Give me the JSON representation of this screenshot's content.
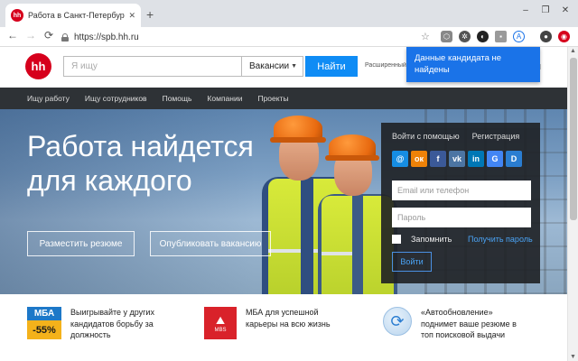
{
  "browser": {
    "tab_title": "Работа в Санкт-Петербурге, по",
    "tab_favicon_text": "hh",
    "tab_close": "✕",
    "new_tab": "+",
    "url": "https://spb.hh.ru",
    "window_controls": [
      "–",
      "❐",
      "✕"
    ]
  },
  "header": {
    "logo_text": "hh",
    "search_placeholder": "Я ищу",
    "search_scope": "Вакансии",
    "find_button": "Найти",
    "advanced_link": "Расширенный"
  },
  "extension_popup": {
    "message": "Данные кандидата не найдены"
  },
  "nav": {
    "items": [
      "Ищу работу",
      "Ищу сотрудников",
      "Помощь",
      "Компании",
      "Проекты"
    ]
  },
  "hero": {
    "title_line1": "Работа найдется",
    "title_line2": "для каждого",
    "post_resume_button": "Разместить резюме",
    "publish_vacancy_button": "Опубликовать вакансию"
  },
  "login": {
    "tab_social": "Войти с помощью",
    "tab_register": "Регистрация",
    "socials": [
      {
        "label": "@",
        "color": "#168de2"
      },
      {
        "label": "ок",
        "color": "#ee8208"
      },
      {
        "label": "f",
        "color": "#3b5998"
      },
      {
        "label": "vk",
        "color": "#4c75a3"
      },
      {
        "label": "in",
        "color": "#0077b5"
      },
      {
        "label": "G",
        "color": "#4285f4"
      },
      {
        "label": "D",
        "color": "#2a7dd1"
      }
    ],
    "email_placeholder": "Email или телефон",
    "password_placeholder": "Пароль",
    "remember_label": "Запомнить",
    "forgot_link": "Получить пароль",
    "submit_button": "Войти"
  },
  "promos": [
    {
      "badge_top": "МБА",
      "badge_bottom": "-55%",
      "text": "Выигрывайте у других кандидатов борьбу за должность"
    },
    {
      "badge": "MBS",
      "text": "МБА для успешной карьеры на всю жизнь"
    },
    {
      "badge": "⟳",
      "text": "«Автообновление» поднимет ваше резюме в топ поисковой выдачи"
    }
  ],
  "colors": {
    "brand_red": "#d6001c",
    "find_blue": "#0f8cf5",
    "nav_dark": "#2e3236",
    "popup_blue": "#1a73e8"
  }
}
